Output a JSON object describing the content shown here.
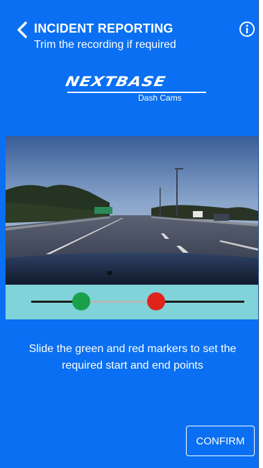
{
  "header": {
    "title": "INCIDENT REPORTING",
    "subtitle": "Trim the recording if required",
    "back_icon": "chevron-left-icon",
    "info_icon": "info-icon"
  },
  "logo": {
    "brand": "NEXTBASE",
    "tagline": "Dash Cams"
  },
  "video": {
    "description_icon": "video-frame"
  },
  "trim": {
    "start_marker_color": "#19a04a",
    "end_marker_color": "#e0231b",
    "start_fraction": 0.24,
    "end_fraction": 0.59
  },
  "instructions": "Slide the green and red markers to set the required start and end points",
  "actions": {
    "confirm_label": "CONFIRM"
  },
  "colors": {
    "background": "#0a6ff2",
    "trim_bar": "#7fd3d9",
    "text": "#ffffff"
  }
}
